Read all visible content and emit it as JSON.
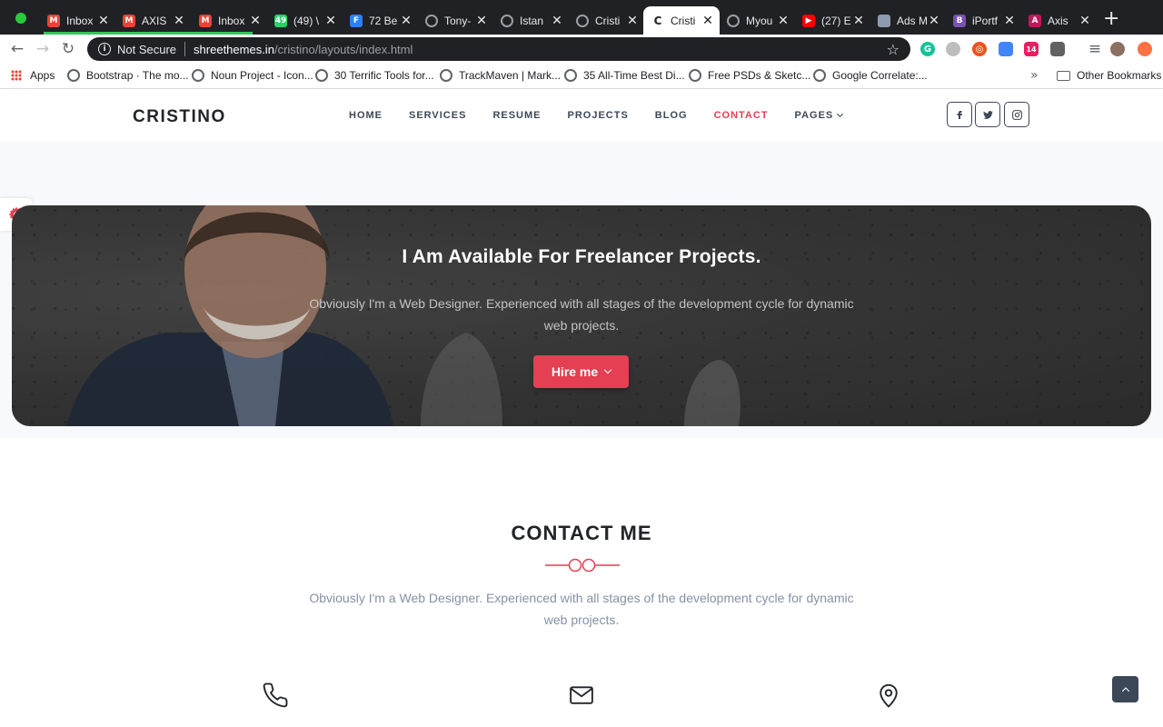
{
  "browser": {
    "tabs": [
      {
        "title": "Inbox",
        "favicon": "gmail-icon",
        "color": "#ea4335",
        "letter": "M"
      },
      {
        "title": "AXIS",
        "favicon": "gmail-icon",
        "color": "#ea4335",
        "letter": "M"
      },
      {
        "title": "Inbox",
        "favicon": "gmail-icon",
        "color": "#ea4335",
        "letter": "M"
      },
      {
        "title": "(49) \\",
        "favicon": "whatsapp-icon",
        "color": "#25d366",
        "letter": "49"
      },
      {
        "title": "72 Be",
        "favicon": "f-icon",
        "color": "#2d7ff9",
        "letter": "F"
      },
      {
        "title": "Tony-",
        "favicon": "globe-icon",
        "color": "#5f6368",
        "letter": ""
      },
      {
        "title": "Istan",
        "favicon": "globe-icon",
        "color": "#5f6368",
        "letter": ""
      },
      {
        "title": "Cristi",
        "favicon": "globe-icon",
        "color": "#5f6368",
        "letter": ""
      },
      {
        "title": "Cristi",
        "favicon": "c-icon",
        "color": "#202124",
        "letter": "C"
      },
      {
        "title": "Myou",
        "favicon": "globe-icon",
        "color": "#5f6368",
        "letter": ""
      },
      {
        "title": "(27) E",
        "favicon": "youtube-icon",
        "color": "#ff0000",
        "letter": "▶"
      },
      {
        "title": "Ads M",
        "favicon": "doc-icon",
        "color": "#8e9aaf",
        "letter": ""
      },
      {
        "title": "iPortf",
        "favicon": "bootstrap-icon",
        "color": "#7952b3",
        "letter": "B"
      },
      {
        "title": "Axis",
        "favicon": "axis-icon",
        "color": "#c2185b",
        "letter": "A"
      }
    ],
    "active_tab_index": 8,
    "close_glyph": "✕",
    "new_tab_glyph": "+",
    "address": {
      "security": "Not Secure",
      "host": "shreethemes.in",
      "path": "/cristino/layouts/index.html"
    },
    "bookmarks": [
      {
        "label": "Apps",
        "icon": "apps-grid-icon"
      },
      {
        "label": "Bootstrap · The mo...",
        "icon": "globe-icon"
      },
      {
        "label": "Noun Project - Icon...",
        "icon": "globe-icon"
      },
      {
        "label": "30 Terrific Tools for...",
        "icon": "globe-icon"
      },
      {
        "label": "TrackMaven | Mark...",
        "icon": "globe-icon"
      },
      {
        "label": "35 All-Time Best Di...",
        "icon": "globe-icon"
      },
      {
        "label": "Free PSDs & Sketc...",
        "icon": "globe-icon"
      },
      {
        "label": "Google Correlate:...",
        "icon": "globe-icon"
      }
    ],
    "other_bookmarks": "Other Bookmarks",
    "overflow_glyph": "»",
    "extensions": [
      {
        "name": "grammarly-icon",
        "color": "#15c39a",
        "letter": "G"
      },
      {
        "name": "vpn-icon",
        "color": "#bdbdbd",
        "letter": ""
      },
      {
        "name": "ubuntu-icon",
        "color": "#e95420",
        "letter": "◎"
      },
      {
        "name": "calendar-icon",
        "color": "#4285f4",
        "letter": ""
      },
      {
        "name": "m-badge-icon",
        "color": "#e91e63",
        "letter": "14"
      },
      {
        "name": "screenshot-icon",
        "color": "#616161",
        "letter": ""
      }
    ]
  },
  "site": {
    "logo": "CRISTINO",
    "nav": [
      {
        "label": "HOME",
        "active": false
      },
      {
        "label": "SERVICES",
        "active": false
      },
      {
        "label": "RESUME",
        "active": false
      },
      {
        "label": "PROJECTS",
        "active": false
      },
      {
        "label": "BLOG",
        "active": false
      },
      {
        "label": "CONTACT",
        "active": true
      },
      {
        "label": "PAGES",
        "active": false,
        "dropdown": true
      }
    ],
    "social": [
      "facebook-icon",
      "twitter-icon",
      "instagram-icon"
    ],
    "accent_color": "#e43f52"
  },
  "cta": {
    "title": "I Am Available For Freelancer Projects.",
    "text": "Obviously I'm a Web Designer. Experienced with all stages of the development cycle for dynamic web projects.",
    "button": "Hire me"
  },
  "contact": {
    "title": "CONTACT ME",
    "text": "Obviously I'm a Web Designer. Experienced with all stages of the development cycle for dynamic web projects.",
    "icons": [
      "phone-icon",
      "mail-icon",
      "map-pin-icon"
    ]
  }
}
